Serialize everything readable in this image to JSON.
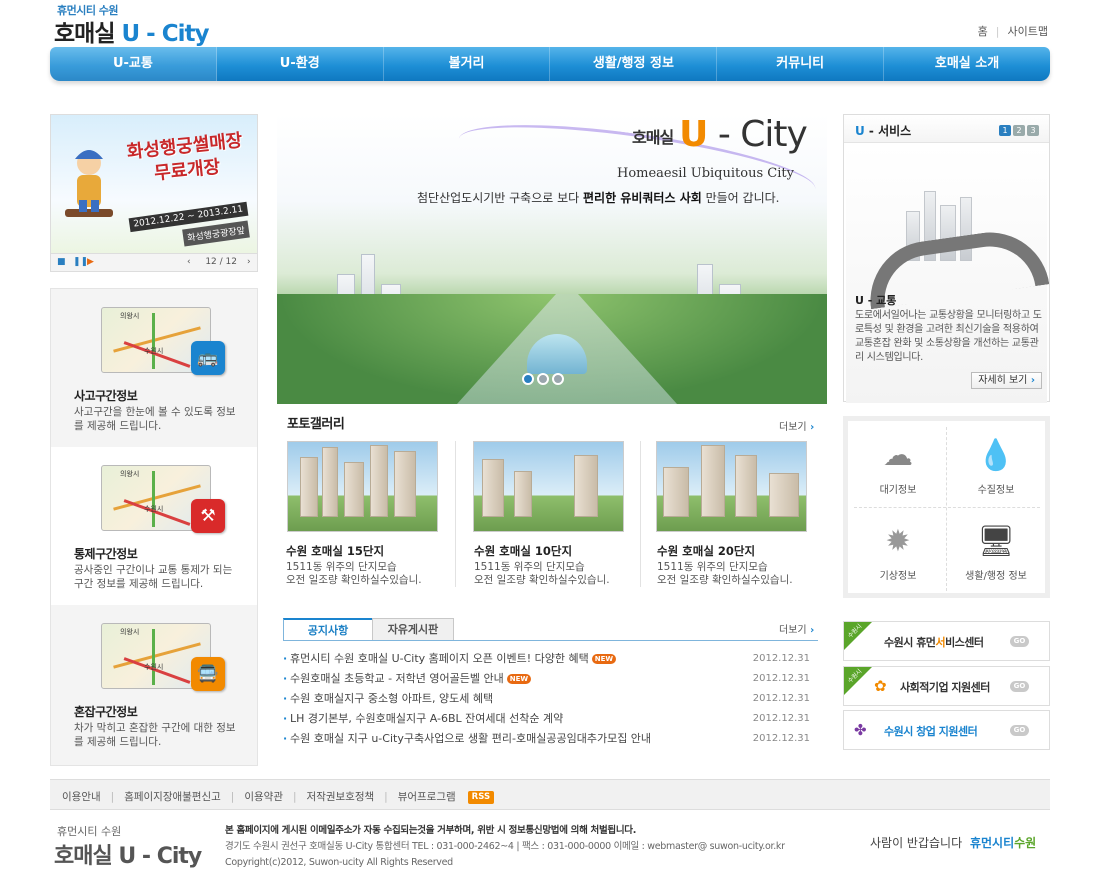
{
  "header": {
    "logo_small": "휴먼시티 수원",
    "logo_big_main": "호매실",
    "logo_big_u": "U - City",
    "top_links": [
      "홈",
      "사이트맵"
    ]
  },
  "nav": {
    "items": [
      "U-교통",
      "U-환경",
      "볼거리",
      "생활/행정 정보",
      "커뮤니티",
      "호매실 소개"
    ],
    "active_index": 0
  },
  "banner": {
    "title": "화성행궁썰매장 무료개장",
    "date": "2012.12.22 ~ 2013.2.11",
    "place": "화성행궁광장앞",
    "pager": "12 / 12"
  },
  "left_services": [
    {
      "title": "사고구간정보",
      "desc": "사고구간을 한눈에 볼 수 있도록 정보를 제공해 드립니다.",
      "icon": "bus-accident-icon",
      "icon_color": "#1a84cf",
      "map_label_1": "의왕시",
      "map_label_2": "수원시"
    },
    {
      "title": "통제구간정보",
      "desc": "공사중인 구간이나 교통 통제가 되는 구간 정보를 제공해 드립니다.",
      "icon": "roadwork-icon",
      "icon_color": "#d92a2a",
      "map_label_1": "의왕시",
      "map_label_2": "수원시"
    },
    {
      "title": "혼잡구간정보",
      "desc": "차가 막히고 혼잡한 구간에 대한 정보를 제공해 드립니다.",
      "icon": "congestion-icon",
      "icon_color": "#f28a00",
      "map_label_1": "의왕시",
      "map_label_2": "수원시"
    }
  ],
  "hero": {
    "title_pre": "호매실",
    "title_u": "U",
    "title_rest": " - City",
    "subtitle": "Homeaesil Ubiquitous City",
    "slogan_a": "첨단산업도시기반 구축으로 보다 ",
    "slogan_b": "편리한 유비쿼터스 사회",
    "slogan_c": " 만들어 갑니다."
  },
  "gallery": {
    "title": "포토갤러리",
    "more": "더보기",
    "items": [
      {
        "title": "수원 호매실 15단지",
        "desc": "1511동 위주의 단지모습\n오전 일조량 확인하실수있습니."
      },
      {
        "title": "수원 호매실 10단지",
        "desc": "1511동 위주의 단지모습\n오전 일조량 확인하실수있습니."
      },
      {
        "title": "수원 호매실 20단지",
        "desc": "1511동 위주의 단지모습\n오전 일조량 확인하실수있습니."
      }
    ]
  },
  "notice": {
    "tabs": [
      "공지사항",
      "자유게시판"
    ],
    "more": "더보기",
    "items": [
      {
        "text": "휴먼시티 수원 호매실 U-City 홈페이지 오픈 이벤트! 다양한 혜택",
        "new": "NEW",
        "date": "2012.12.31"
      },
      {
        "text": "수원호매실 초등학교 - 저학년 영어골든벨 안내",
        "new": "NEW",
        "date": "2012.12.31"
      },
      {
        "text": "수원 호매실지구 중소형 아파트, 양도세 혜택",
        "new": "",
        "date": "2012.12.31"
      },
      {
        "text": "LH 경기본부, 수원호매실지구 A-6BL 잔여세대 선착순 계약",
        "new": "",
        "date": "2012.12.31"
      },
      {
        "text": "수원 호매실 지구 u-City구축사업으로 생활 편리-호매실공공임대추가모집 안내",
        "new": "",
        "date": "2012.12.31"
      }
    ]
  },
  "u_service": {
    "title_u": "U",
    "title_rest": " - 서비스",
    "pages": [
      "1",
      "2",
      "3"
    ],
    "sub_title": "U - 교통",
    "desc": "도로에서일어나는 교통상황을 모니터링하고 도로특성 및 환경을 고려한 최신기술을 적용하여 교통혼잡 완화 및 소통상황을 개선하는 교통관리 시스템입니다.",
    "more": "자세히 보기"
  },
  "info_grid": [
    {
      "label": "대기정보",
      "icon": "cloud-icon"
    },
    {
      "label": "수질정보",
      "icon": "water-drop-icon"
    },
    {
      "label": "기상정보",
      "icon": "sun-icon"
    },
    {
      "label": "생활/행정 정보",
      "icon": "monitor-icon"
    }
  ],
  "quick_links": [
    {
      "ribbon": "수원시",
      "pre": "수원시 휴먼",
      "hl": "서",
      "post": "비스센터",
      "go": "GO"
    },
    {
      "ribbon": "수원시",
      "pre": "",
      "hl": "",
      "post": "사회적기업 지원센터",
      "go": "GO"
    },
    {
      "ribbon": "",
      "pre": "수원시 창업 지원센터",
      "hl": "",
      "post": "",
      "go": "GO"
    }
  ],
  "footer": {
    "links": [
      "이용안내",
      "홈페이지장애불편신고",
      "이용약관",
      "저작권보호정책",
      "뷰어프로그램"
    ],
    "rss": "RSS",
    "logo_small": "휴먼시티 수원",
    "logo_big_main": "호매실",
    "logo_big_u": "U - City",
    "line1": "본 홈페이지에 게시된 이메일주소가 자동 수집되는것을 거부하며, 위반 시 정보통신망법에 의해 처벌됩니다.",
    "line2": "경기도 수원시 권선구 호매실동 U-City 통합센터 TEL : 031-000-2462~4  |  팩스 : 031-000-0000   이메일 : webmaster@ suwon-ucity.or.kr",
    "line3": "Copyright(c)2012, Suwon-ucity All Rights Reserved",
    "greeting": "사람이 반갑습니다",
    "brand_a": "휴먼시티",
    "brand_b": "수원"
  }
}
